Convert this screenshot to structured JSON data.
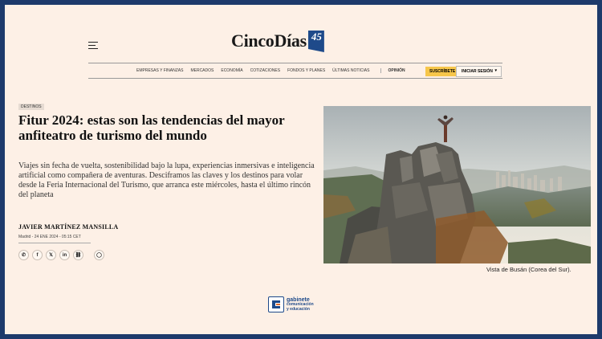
{
  "header": {
    "logo_text": "CincoDías",
    "logo_badge": "45",
    "menu_icon": "hamburger-icon"
  },
  "nav": {
    "items": [
      "Empresas y finanzas",
      "Mercados",
      "Economía",
      "Cotizaciones",
      "Fondos y planes",
      "Últimas noticias"
    ],
    "opinion": "Opinión",
    "subscribe": "Suscríbete",
    "login": "Iniciar sesión",
    "login_icon": "chevron-down-icon"
  },
  "article": {
    "section_tag": "Destinos",
    "headline": "Fitur 2024: estas son las tendencias del mayor anfiteatro de turismo del mundo",
    "standfirst": "Viajes sin fecha de vuelta, sostenibilidad bajo la lupa, experiencias inmersivas e inteligencia artificial como compañera de aventuras. Desciframos las claves y los destinos para volar desde la Feria Internacional del Turismo, que arranca este miércoles, hasta el último rincón del planeta",
    "author": "Javier Martínez Mansilla",
    "dateline": "Madrid - 24 ENE 2024 - 05:15 CET",
    "share_icons": [
      "whatsapp-icon",
      "facebook-icon",
      "x-icon",
      "linkedin-icon",
      "link-icon",
      "comment-icon"
    ],
    "share_glyphs": [
      "✆",
      "f",
      "𝕏",
      "in",
      "⛓",
      "◯"
    ],
    "image_caption": "Vista de Busán (Corea del Sur)."
  },
  "footer": {
    "brand_line1": "gabinete",
    "brand_line2": "comunicación",
    "brand_line3": "y educación"
  },
  "colors": {
    "frame_border": "#1d3a6b",
    "page_bg": "#fdf0e6",
    "subscribe_bg": "#f6c64a",
    "brand_blue": "#1e4a8a"
  }
}
